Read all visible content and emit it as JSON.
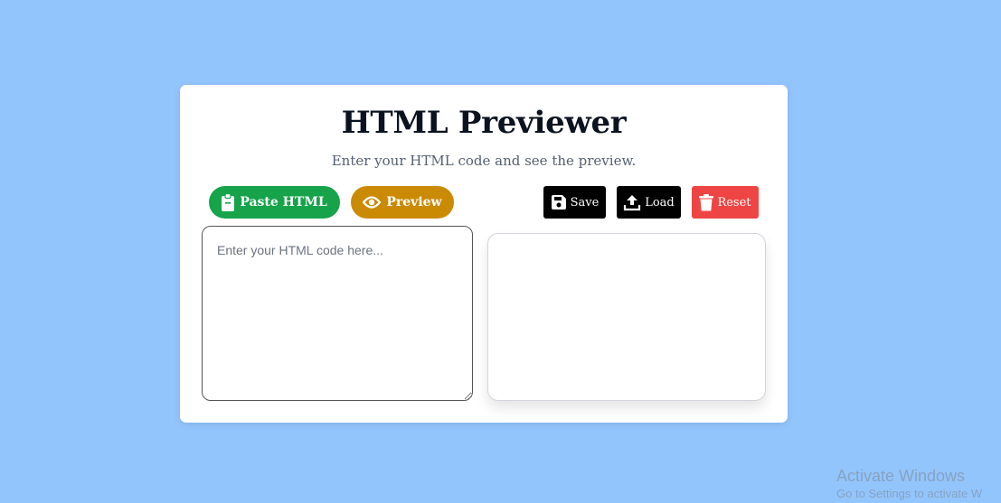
{
  "app": {
    "title": "HTML Previewer",
    "subtitle": "Enter your HTML code and see the preview."
  },
  "toolbar": {
    "paste_label": "Paste HTML",
    "preview_label": "Preview",
    "save_label": "Save",
    "load_label": "Load",
    "reset_label": "Reset",
    "icons": {
      "paste": "clipboard-icon",
      "preview": "eye-icon",
      "save": "floppy-disk-icon",
      "load": "upload-icon",
      "reset": "trash-icon"
    }
  },
  "editor": {
    "value": "",
    "placeholder": "Enter your HTML code here..."
  },
  "colors": {
    "background": "#93c5fd",
    "paste": "#16a34a",
    "preview": "#ca8a04",
    "save": "#000000",
    "load": "#000000",
    "reset": "#ef4444"
  },
  "os_watermark": {
    "title": "Activate Windows",
    "subtitle": "Go to Settings to activate W"
  }
}
